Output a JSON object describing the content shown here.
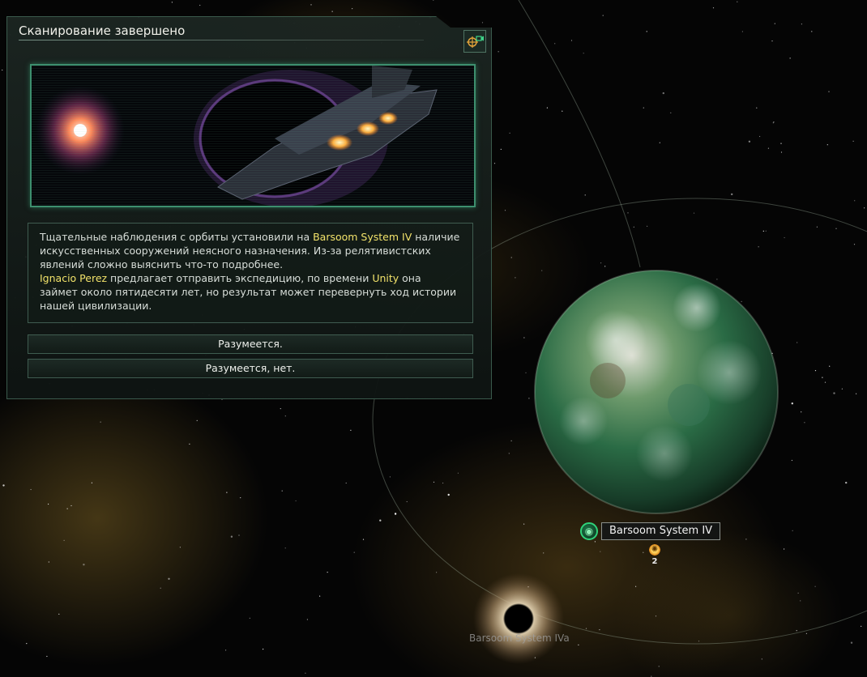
{
  "event_dialog": {
    "title": "Сканирование завершено",
    "focus_icon": "camera-target-icon",
    "image_icon": "spaceship-illustration",
    "text": {
      "p1_a": "Тщательные наблюдения с орбиты установили на ",
      "p1_planet": "Barsoom System IV",
      "p1_b": " наличие искусственных сооружений неясного назначения. Из-за релятивистских явлений сложно выяснить что-то подробнее.",
      "p2_leader": "Ignacio Perez",
      "p2_a": " предлагает отправить экспедицию, по времени ",
      "p2_unity": "Unity",
      "p2_b": " она займет около пятидесяти лет, но результат может перевернуть ход истории нашей цивилизации."
    },
    "options": [
      "Разумеется.",
      "Разумеется, нет."
    ]
  },
  "map": {
    "planet": {
      "name": "Barsoom System IV",
      "type_icon": "continental-planet-icon",
      "resource_icon": "energy-resource-icon",
      "resource_count": "2"
    },
    "moon": {
      "name": "Barsoom System IVa"
    }
  },
  "colors": {
    "highlight": "#f2e26a",
    "panel_border": "#3a5a4c",
    "accent_green": "#3d8f6e"
  }
}
